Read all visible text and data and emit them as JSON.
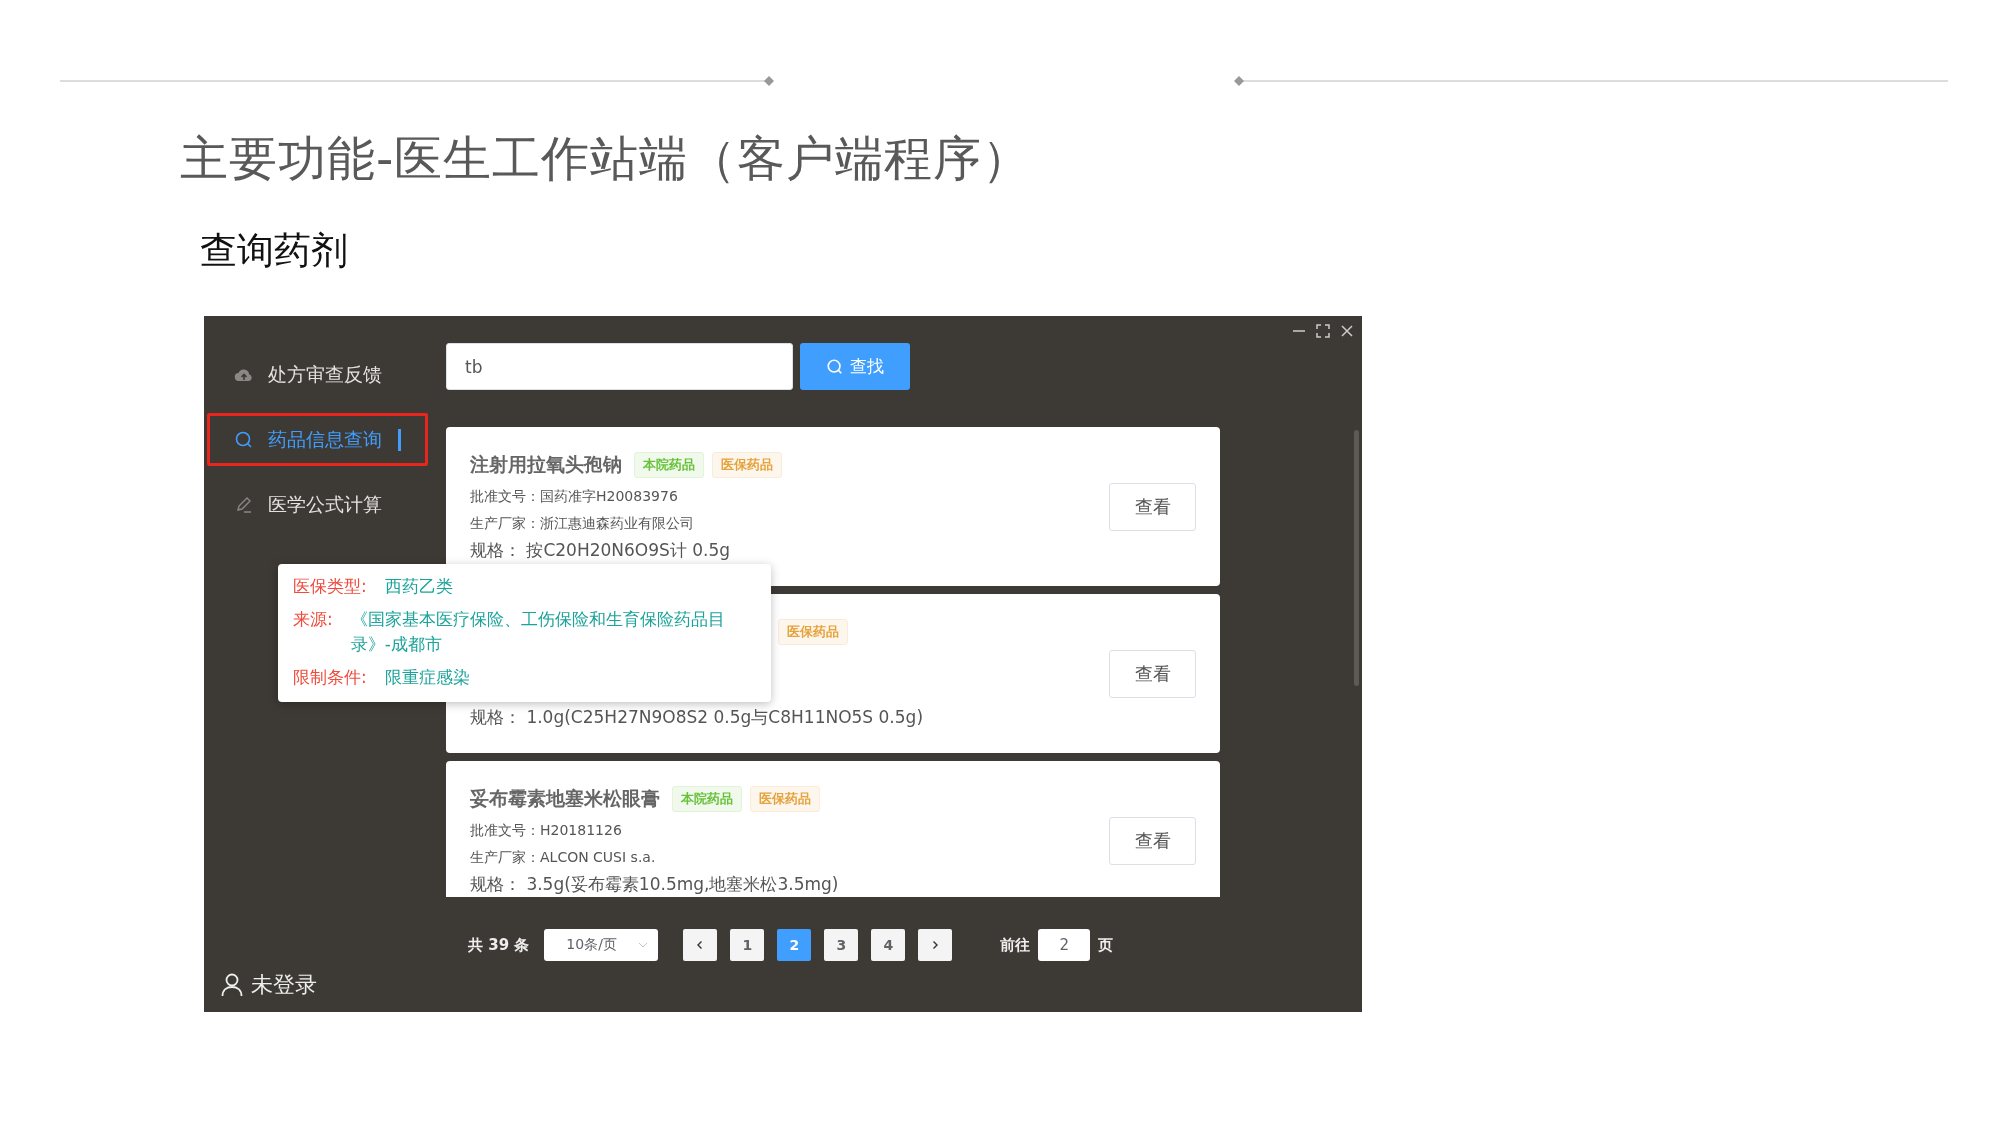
{
  "slide": {
    "title": "主要功能-医生工作站端（客户端程序）",
    "subtitle": "查询药剂"
  },
  "sidebar": {
    "items": [
      {
        "label": "处方审查反馈",
        "kind": "cloud",
        "selected": false
      },
      {
        "label": "药品信息查询",
        "kind": "search",
        "selected": true
      },
      {
        "label": "医学公式计算",
        "kind": "pen",
        "selected": false
      }
    ],
    "user": "未登录"
  },
  "search": {
    "value": "tb",
    "button": "查找"
  },
  "results": [
    {
      "title": "注射用拉氧头孢钠",
      "tags": [
        {
          "label": "本院药品",
          "kind": "hospital"
        },
        {
          "label": "医保药品",
          "kind": "insurance"
        }
      ],
      "approval": "批准文号：国药准字H20083976",
      "maker": "生产厂家：浙江惠迪森药业有限公司",
      "spec": "规格： 按C20H20N6O9S计 0.5g",
      "button": "查看"
    },
    {
      "tags": [
        {
          "label": "医保药品",
          "kind": "insurance"
        }
      ],
      "spec": "规格： 1.0g(C25H27N9O8S2 0.5g与C8H11NO5S 0.5g)",
      "button": "查看"
    },
    {
      "title": "妥布霉素地塞米松眼膏",
      "tags": [
        {
          "label": "本院药品",
          "kind": "hospital"
        },
        {
          "label": "医保药品",
          "kind": "insurance"
        }
      ],
      "approval": "批准文号：H20181126",
      "maker": "生产厂家：ALCON CUSI s.a.",
      "spec": "规格： 3.5g(妥布霉素10.5mg,地塞米松3.5mg)",
      "button": "查看"
    }
  ],
  "popup": {
    "rows": [
      {
        "label": "医保类型:",
        "value": "西药乙类"
      },
      {
        "label": "来源:",
        "value": "《国家基本医疗保险、工伤保险和生育保险药品目录》-成都市"
      },
      {
        "label": "限制条件:",
        "value": "限重症感染"
      }
    ]
  },
  "pagination": {
    "total": "共 39 条",
    "page_size": "10条/页",
    "pages": [
      {
        "label": "1",
        "selected": false
      },
      {
        "label": "2",
        "selected": true
      },
      {
        "label": "3",
        "selected": false
      },
      {
        "label": "4",
        "selected": false
      }
    ],
    "goto_label": "前往",
    "goto_value": "2",
    "goto_suffix": "页"
  }
}
